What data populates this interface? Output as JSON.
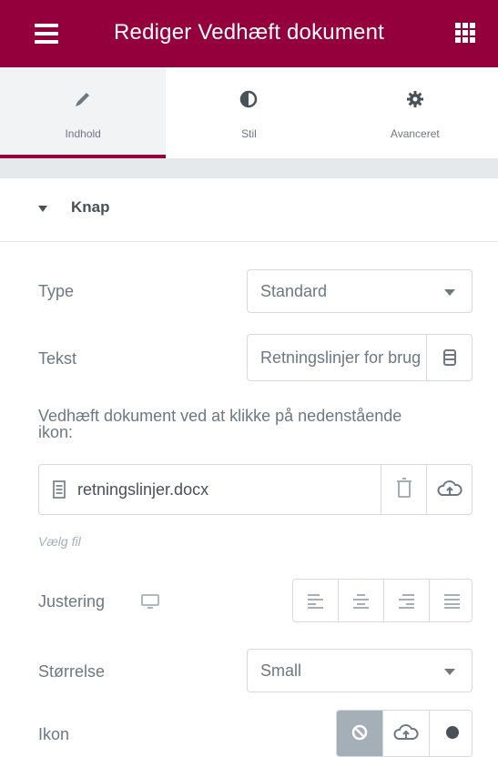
{
  "header": {
    "title": "Rediger Vedhæft dokument",
    "menu_icon": "hamburger-icon",
    "apps_icon": "grid-icon",
    "background": "#93003c"
  },
  "tabs": [
    {
      "label": "Indhold",
      "icon": "pencil-icon",
      "active": true
    },
    {
      "label": "Stil",
      "icon": "contrast-icon",
      "active": false
    },
    {
      "label": "Avanceret",
      "icon": "gear-icon",
      "active": false
    }
  ],
  "section": {
    "title": "Knap",
    "expanded": true
  },
  "fields": {
    "type": {
      "label": "Type",
      "value": "Standard"
    },
    "text": {
      "label": "Tekst",
      "value": "Retningslinjer for brug"
    },
    "attach": {
      "description": "Vedhæft dokument ved at klikke på nedenstående ikon:",
      "filename": "retningslinjer.docx",
      "choose_file": "Vælg fil"
    },
    "alignment": {
      "label": "Justering",
      "options": [
        "left",
        "center",
        "right",
        "justify"
      ]
    },
    "size": {
      "label": "Størrelse",
      "value": "Small"
    },
    "icon": {
      "label": "Ikon",
      "options": [
        "none",
        "library",
        "upload"
      ],
      "selected": "none"
    }
  }
}
